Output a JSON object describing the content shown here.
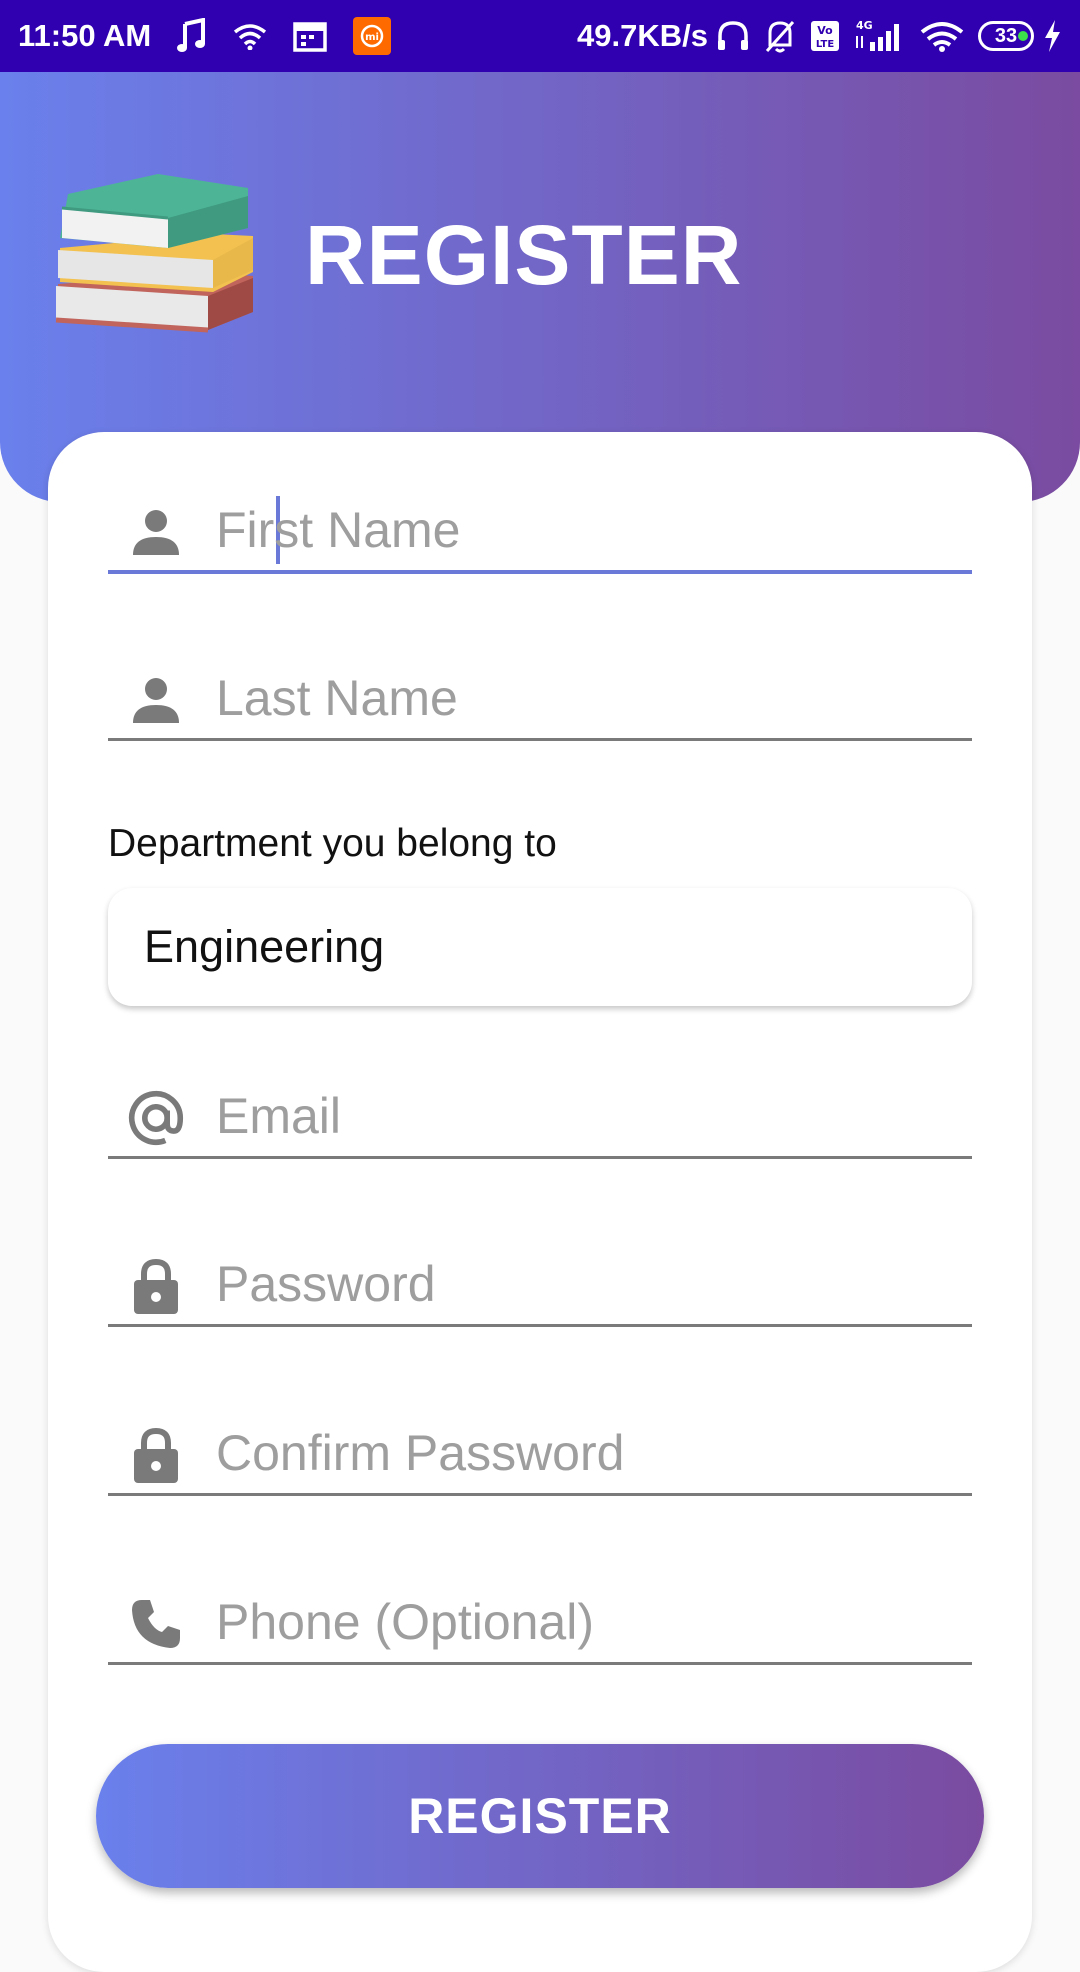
{
  "status_bar": {
    "time": "11:50 AM",
    "network_speed": "49.7KB/s",
    "network_type": "4G",
    "volte": "Vo LTE",
    "battery_level": "33",
    "icons": [
      "music-note-icon",
      "wifi-icon",
      "calendar-icon",
      "mi-icon",
      "headphones-icon",
      "bell-off-icon",
      "volte-icon",
      "signal-icon",
      "wifi-icon",
      "battery-icon",
      "charging-icon"
    ]
  },
  "header": {
    "title": "REGISTER",
    "logo_icon": "books-icon"
  },
  "form": {
    "first_name": {
      "placeholder": "First Name",
      "value": "",
      "icon": "person-icon",
      "focused": true
    },
    "last_name": {
      "placeholder": "Last Name",
      "value": "",
      "icon": "person-icon"
    },
    "department": {
      "label": "Department you belong to",
      "selected": "Engineering"
    },
    "email": {
      "placeholder": "Email",
      "value": "",
      "icon": "at-sign-icon"
    },
    "password": {
      "placeholder": "Password",
      "value": "",
      "icon": "lock-icon"
    },
    "confirm_password": {
      "placeholder": "Confirm Password",
      "value": "",
      "icon": "lock-icon"
    },
    "phone": {
      "placeholder": "Phone (Optional)",
      "value": "",
      "icon": "phone-icon"
    }
  },
  "register_button": {
    "label": "REGISTER"
  },
  "colors": {
    "status_bar": "#3000b0",
    "gradient_start": "#6a80ec",
    "gradient_end": "#7a4ba0",
    "focus_accent": "#6a78d8",
    "icon_gray": "#7a7a7a",
    "placeholder_gray": "#9e9e9e"
  }
}
